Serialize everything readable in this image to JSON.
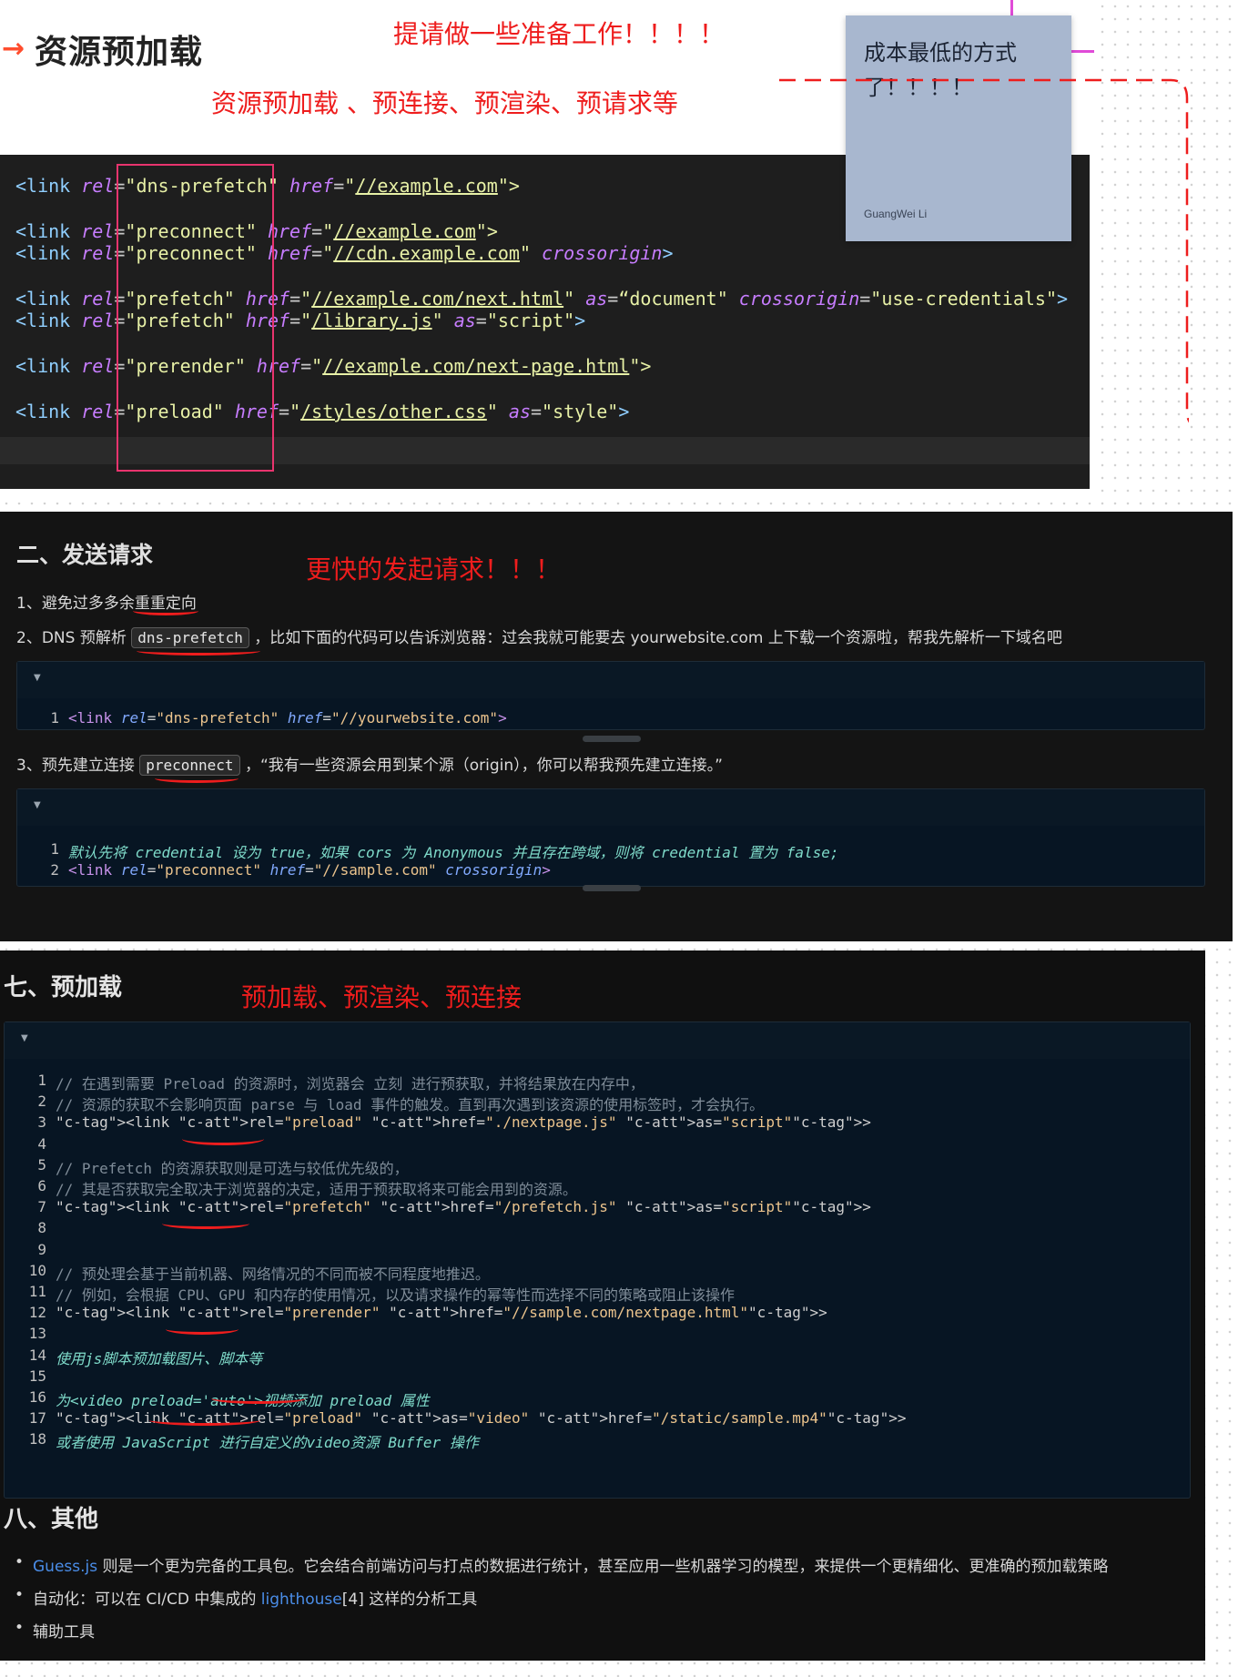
{
  "panel1": {
    "arrow": "→",
    "title": "资源预加载",
    "note_top": "提请做一些准备工作！！！！",
    "note_sub": "资源预加载 、预连接、预渲染、预请求等",
    "code": [
      {
        "tag": "<link ",
        "rel_attr": "rel",
        "rel_val": "\"dns-prefetch\"",
        "href_attr": "href",
        "href_val": "//example.com",
        "rest": "\">"
      },
      {
        "tag": "<link ",
        "rel_attr": "rel",
        "rel_val": "\"preconnect\"",
        "href_attr": "href",
        "href_val": "//example.com",
        "rest": "\">"
      },
      {
        "tag": "<link ",
        "rel_attr": "rel",
        "rel_val": "\"preconnect\"",
        "href_attr": "href",
        "href_val": "//cdn.example.com",
        "rest": "\"",
        "extra_attr": " crossorigin",
        "end": ">"
      },
      {
        "tag": "<link ",
        "rel_attr": "rel",
        "rel_val": "\"prefetch\"",
        "href_attr": "href",
        "href_val": "//example.com/next.html",
        "rest": "\"",
        "as_attr": " as",
        "as_val": "“document\"",
        "extra_attr": " crossorigin",
        "extra_val": "\"use-credentials\"",
        "end": ">"
      },
      {
        "tag": "<link ",
        "rel_attr": "rel",
        "rel_val": "\"prefetch\"",
        "href_attr": "href",
        "href_val": "/library.js",
        "rest": "\"",
        "as_attr": " as",
        "as_val": "\"script\"",
        "end": ">"
      },
      {
        "tag": "<link ",
        "rel_attr": "rel",
        "rel_val": "\"prerender\"",
        "href_attr": "href",
        "href_val": "//example.com/next-page.html",
        "rest": "\">"
      },
      {
        "tag": "<link ",
        "rel_attr": "rel",
        "rel_val": "\"preload\"",
        "href_attr": "href",
        "href_val": "/styles/other.css",
        "rest": "\"",
        "as_attr": " as",
        "as_val": "\"style\"",
        "end": ">"
      }
    ],
    "sticky": {
      "text": "成本最低的方式了！！！！",
      "author": "GuangWei Li"
    }
  },
  "panel2": {
    "title": "二、发送请求",
    "note": "更快的发起请求！！！",
    "item1": "1、避免过多多余重重定向",
    "item2_pre": "2、DNS 预解析",
    "item2_chip": "dns-prefetch",
    "item2_post": "，比如下面的代码可以告诉浏览器：过会我就可能要去 yourwebsite.com 上下载一个资源啦，帮我先解析一下域名吧",
    "block1": [
      {
        "num": "1",
        "code": "<link rel=\"dns-prefetch\" href=\"//yourwebsite.com\">"
      }
    ],
    "item3_pre": "3、预先建立连接",
    "item3_chip": "preconnect",
    "item3_post": "，“我有一些资源会用到某个源（origin），你可以帮我预先建立连接。”",
    "block2": [
      {
        "num": "1",
        "code": "默认先将 credential 设为 true，如果 cors 为 Anonymous 并且存在跨域，则将 credential 置为 false;"
      },
      {
        "num": "2",
        "code": "<link rel=\"preconnect\" href=\"//sample.com\" crossorigin>"
      }
    ]
  },
  "panel3": {
    "title": "七、预加载",
    "note": "预加载、预渲染、预连接",
    "lines": [
      {
        "num": "1",
        "text": "// 在遇到需要 Preload 的资源时，浏览器会 立刻 进行预获取，并将结果放在内存中，"
      },
      {
        "num": "2",
        "text": "// 资源的获取不会影响页面 parse 与 load 事件的触发。直到再次遇到该资源的使用标签时，才会执行。"
      },
      {
        "num": "3",
        "text": "<link rel=\"preload\" href=\"./nextpage.js\" as=\"script\">"
      },
      {
        "num": "4",
        "text": ""
      },
      {
        "num": "5",
        "text": "// Prefetch 的资源获取则是可选与较低优先级的，"
      },
      {
        "num": "6",
        "text": "// 其是否获取完全取决于浏览器的决定，适用于预获取将来可能会用到的资源。"
      },
      {
        "num": "7",
        "text": "<link rel=\"prefetch\" href=\"/prefetch.js\" as=\"script\">"
      },
      {
        "num": "8",
        "text": ""
      },
      {
        "num": "9",
        "text": ""
      },
      {
        "num": "10",
        "text": "// 预处理会基于当前机器、网络情况的不同而被不同程度地推迟。"
      },
      {
        "num": "11",
        "text": "// 例如，会根据 CPU、GPU 和内存的使用情况，以及请求操作的幂等性而选择不同的策略或阻止该操作"
      },
      {
        "num": "12",
        "text": "<link rel=\"prerender\" href=\"//sample.com/nextpage.html\">"
      },
      {
        "num": "13",
        "text": ""
      },
      {
        "num": "14",
        "text": "使用js脚本预加载图片、脚本等"
      },
      {
        "num": "15",
        "text": ""
      },
      {
        "num": "16",
        "text": "为<video preload='auto'>视频添加 preload 属性"
      },
      {
        "num": "17",
        "text": "<link rel=\"preload\" as=\"video\" href=\"/static/sample.mp4\">"
      },
      {
        "num": "18",
        "text": "或者使用 JavaScript 进行自定义的video资源 Buffer 操作"
      }
    ]
  },
  "panel4": {
    "title": "八、其他",
    "bullets": [
      {
        "link": "Guess.js",
        "text": " 则是一个更为完备的工具包。它会结合前端访问与打点的数据进行统计，甚至应用一些机器学习的模型，来提供一个更精细化、更准确的预加载策略"
      },
      {
        "pre": "自动化：可以在 CI/CD 中集成的 ",
        "link": "lighthouse",
        "text": "[4] 这样的分析工具"
      },
      {
        "text": "辅助工具"
      }
    ]
  }
}
